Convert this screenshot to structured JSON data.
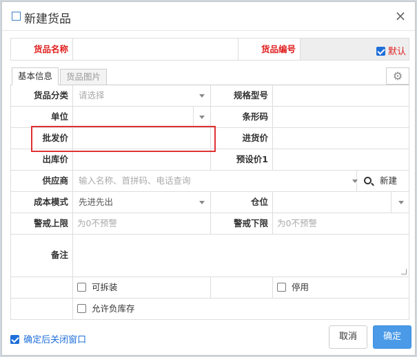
{
  "dialog": {
    "title": "新建货品",
    "close_glyph": "×"
  },
  "top": {
    "name_label": "货品名称",
    "code_label": "货品编号",
    "default_label": "默认",
    "default_checked": true
  },
  "tabs": [
    {
      "label": "基本信息",
      "active": true
    },
    {
      "label": "货品图片",
      "active": false
    }
  ],
  "form": {
    "category_label": "货品分类",
    "category_placeholder": "请选择",
    "spec_label": "规格型号",
    "unit_label": "单位",
    "barcode_label": "条形码",
    "wholesale_label": "批发价",
    "purchase_label": "进货价",
    "outbound_label": "出库价",
    "preset1_label": "预设价1",
    "supplier_label": "供应商",
    "supplier_placeholder": "输入名称、首拼码、电话查询",
    "new_label": "新建",
    "cost_mode_label": "成本模式",
    "cost_mode_value": "先进先出",
    "warehouse_label": "仓位",
    "alert_upper_label": "警戒上限",
    "alert_upper_placeholder": "为0不预警",
    "alert_lower_label": "警戒下限",
    "alert_lower_placeholder": "为0不预警",
    "note_label": "备注",
    "splittable_label": "可拆装",
    "disabled_label": "停用",
    "allow_negative_label": "允许负库存"
  },
  "footer": {
    "close_after_confirm_label": "确定后关闭窗口",
    "close_after_confirm_checked": true,
    "cancel_label": "取消",
    "ok_label": "确定"
  },
  "colors": {
    "accent": "#4a9ae8",
    "required_label": "#e02020",
    "highlight": "#e03030"
  }
}
